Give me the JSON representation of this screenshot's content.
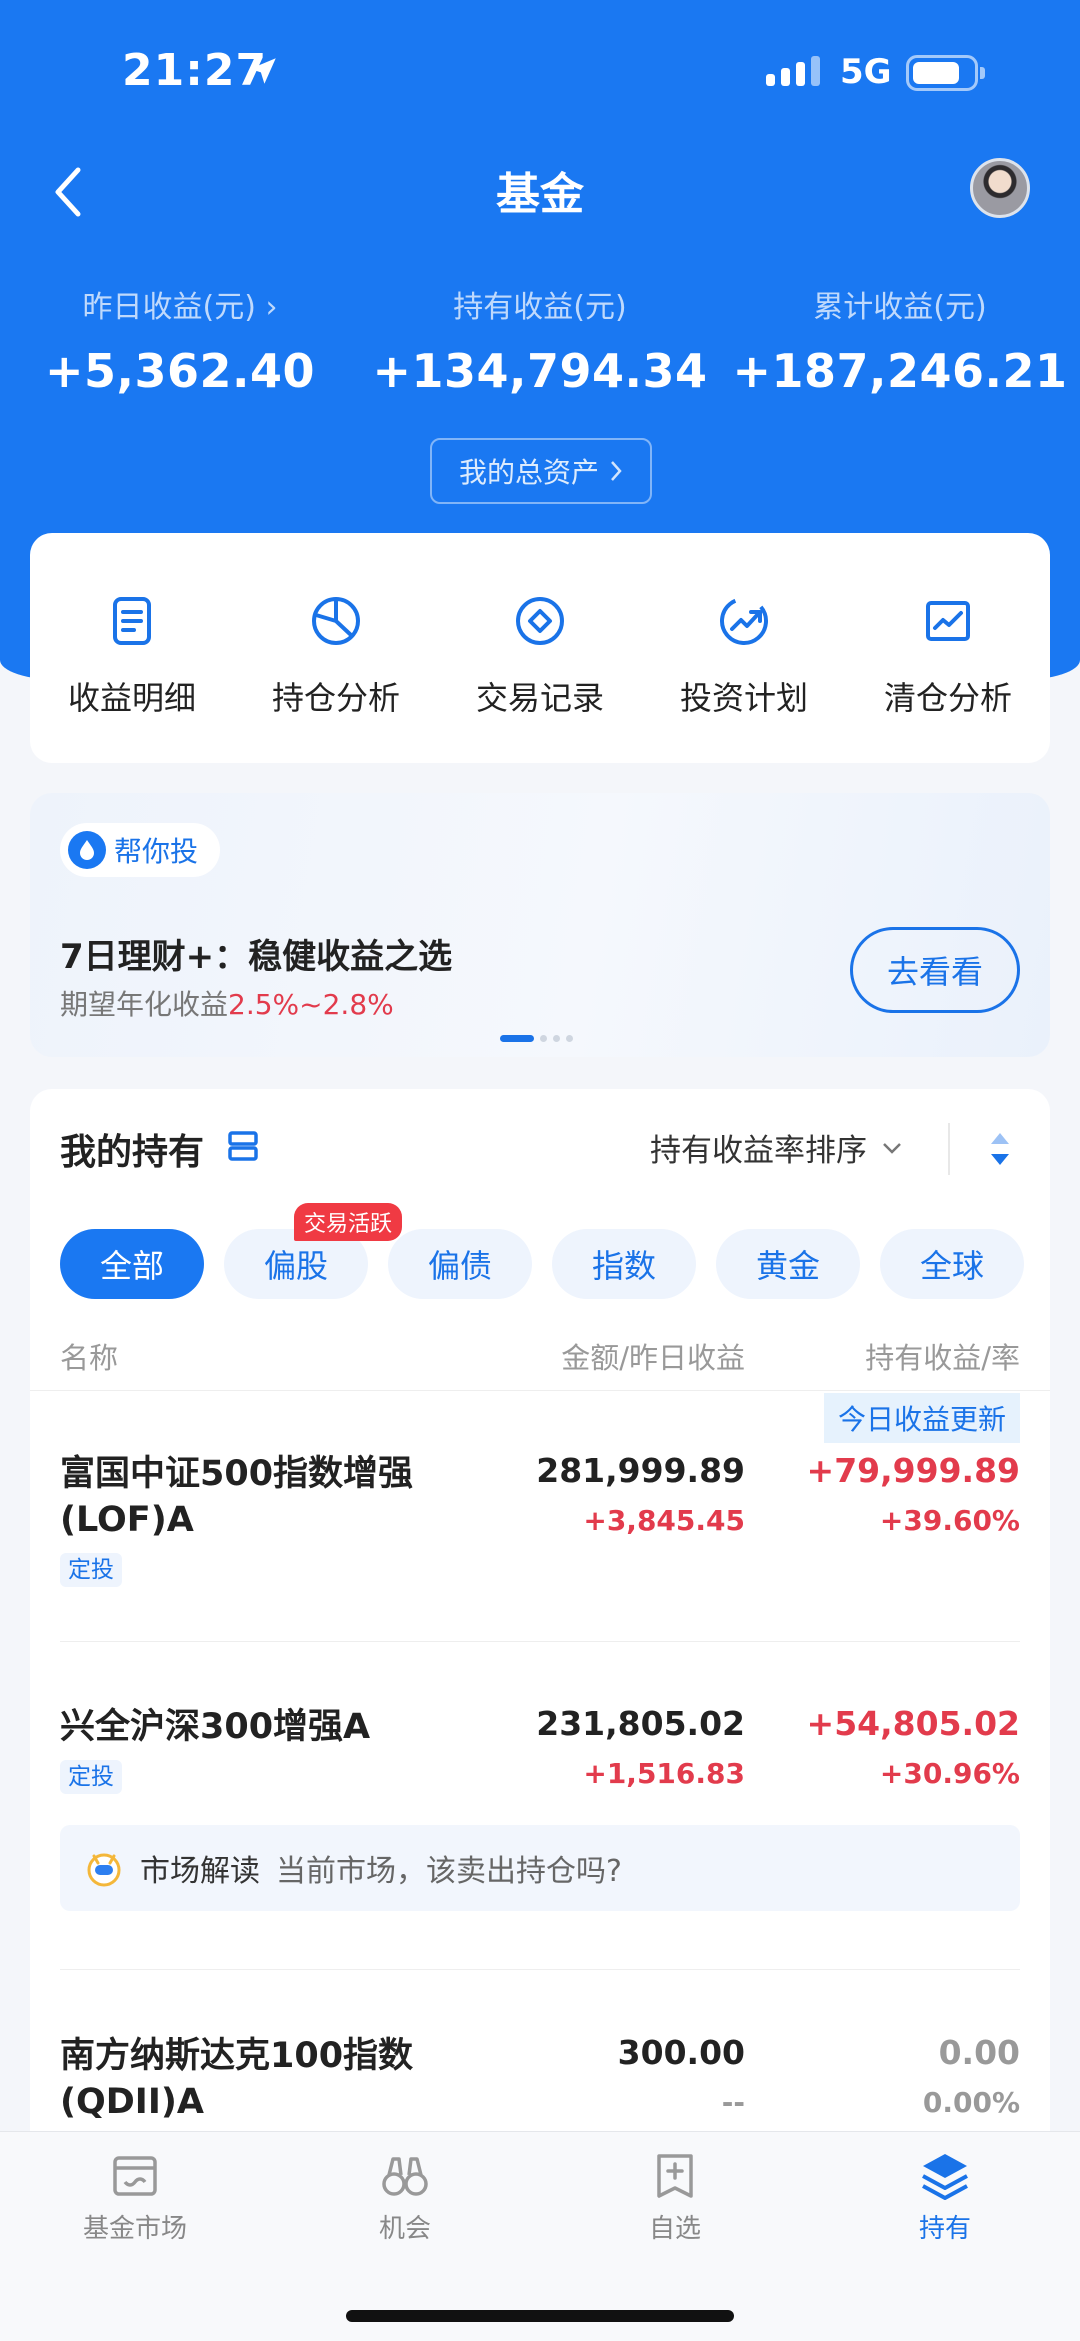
{
  "status_bar": {
    "time": "21:27",
    "network": "5G"
  },
  "nav": {
    "title": "基金"
  },
  "summary": {
    "yesterday_label": "昨日收益(元) ›",
    "yesterday_value": "+5,362.40",
    "holding_label": "持有收益(元)",
    "holding_value": "+134,794.34",
    "total_label": "累计收益(元)",
    "total_value": "+187,246.21",
    "assets_button": "我的总资产"
  },
  "quick_actions": [
    {
      "label": "收益明细",
      "icon": "document-icon"
    },
    {
      "label": "持仓分析",
      "icon": "pie-chart-icon"
    },
    {
      "label": "交易记录",
      "icon": "diamond-circle-icon"
    },
    {
      "label": "投资计划",
      "icon": "trend-up-icon"
    },
    {
      "label": "清仓分析",
      "icon": "line-chart-icon"
    }
  ],
  "promo": {
    "pill": "帮你投",
    "title": "7日理财+：稳健收益之选",
    "subtitle_prefix": "期望年化收益",
    "subtitle_rate": "2.5%~2.8%",
    "button": "去看看"
  },
  "holdings": {
    "title": "我的持有",
    "sort_label": "持有收益率排序",
    "filters": [
      {
        "label": "全部",
        "active": true
      },
      {
        "label": "偏股",
        "badge": "交易活跃"
      },
      {
        "label": "偏债"
      },
      {
        "label": "指数"
      },
      {
        "label": "黄金"
      },
      {
        "label": "全球"
      }
    ],
    "columns": {
      "name": "名称",
      "amount": "金额/昨日收益",
      "profit": "持有收益/率"
    },
    "today_update_tag": "今日收益更新",
    "funds": [
      {
        "name": "富国中证500指数增强(LOF)A",
        "tag": "定投",
        "amount": "281,999.89",
        "yesterday": "+3,845.45",
        "profit": "+79,999.89",
        "rate": "+39.60%"
      },
      {
        "name": "兴全沪深300增强A",
        "tag": "定投",
        "amount": "231,805.02",
        "yesterday": "+1,516.83",
        "profit": "+54,805.02",
        "rate": "+30.96%"
      },
      {
        "name": "南方纳斯达克100指数(QDII)A",
        "tag": "",
        "amount": "300.00",
        "yesterday": "--",
        "profit": "0.00",
        "rate": "0.00%"
      }
    ],
    "insight": {
      "key": "市场解读",
      "text": "当前市场，该卖出持仓吗?"
    }
  },
  "tabbar": [
    {
      "label": "基金市场",
      "icon": "store-icon"
    },
    {
      "label": "机会",
      "icon": "binoculars-icon"
    },
    {
      "label": "自选",
      "icon": "add-watchlist-icon"
    },
    {
      "label": "持有",
      "icon": "layers-icon",
      "active": true
    }
  ],
  "colors": {
    "brand": "#1a78f2",
    "gain": "#e23b4c",
    "muted": "#999999"
  }
}
